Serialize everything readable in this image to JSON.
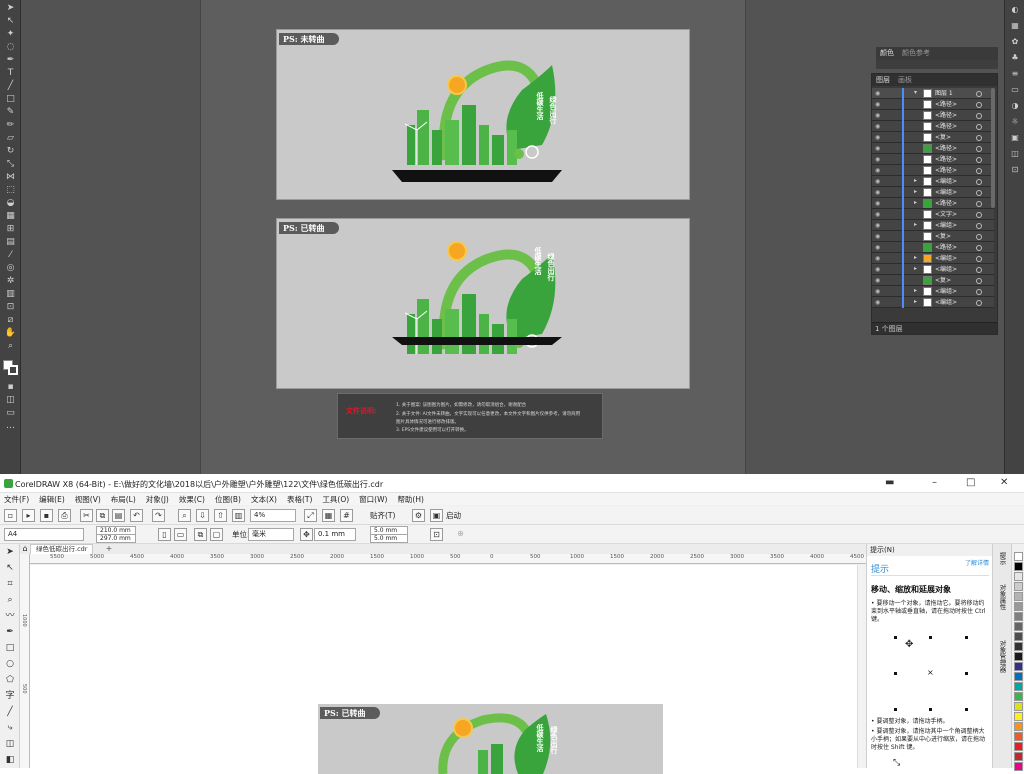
{
  "ai": {
    "poster1_tag": "PS: 未转曲",
    "poster2_tag": "PS: 已转曲",
    "poster_text_a": "低碳生活",
    "poster_text_b": "绿色出行",
    "note": {
      "title": "文件说明:",
      "lines": [
        "1. 关于图案: 该图图为图片，如需修改，请勿取消组合，谢谢配合",
        "2. 关于文件: AI文件未转曲，文字实现可以任意更改，本文件文字和图片仅供参考，请勿商用",
        "   图片具体情况可进行修改排版。",
        "3. EPS文件建议使用可以打开转换。"
      ]
    },
    "swatch_panel": {
      "tab1": "颜色",
      "tab2": "颜色参考"
    },
    "layers_panel": {
      "tab1": "图层",
      "tab2": "画板",
      "footer": "1 个图层",
      "rows": [
        {
          "name": "图层 1",
          "expanded": true
        },
        {
          "name": "<路径>"
        },
        {
          "name": "<路径>"
        },
        {
          "name": "<路径>"
        },
        {
          "name": "<复>"
        },
        {
          "name": "<路径>"
        },
        {
          "name": "<路径>"
        },
        {
          "name": "<路径>"
        },
        {
          "name": "<编组>",
          "arrow": true
        },
        {
          "name": "<编组>",
          "arrow": true
        },
        {
          "name": "<路径>",
          "arrow": true
        },
        {
          "name": "<文字>"
        },
        {
          "name": "<编组>",
          "arrow": true
        },
        {
          "name": "<复>"
        },
        {
          "name": "<路径>"
        },
        {
          "name": "<编组>",
          "arrow": true
        },
        {
          "name": "<编组>",
          "arrow": true
        },
        {
          "name": "<复>"
        },
        {
          "name": "<编组>",
          "arrow": true
        },
        {
          "name": "<编组>",
          "arrow": true
        }
      ]
    }
  },
  "cd": {
    "title": "CorelDRAW X8 (64-Bit) - E:\\做好的文化墙\\2018以后\\户外雕塑\\户外雕塑\\122\\文件\\绿色低碳出行.cdr",
    "menu": [
      "文件(F)",
      "编辑(E)",
      "视图(V)",
      "布局(L)",
      "对象(J)",
      "效果(C)",
      "位图(B)",
      "文本(X)",
      "表格(T)",
      "工具(O)",
      "窗口(W)",
      "帮助(H)"
    ],
    "zoom": "4%",
    "snap": "贴齐(T)",
    "launch": "启动",
    "page_size": "A4",
    "width": "210.0 mm",
    "height": "297.0 mm",
    "unit_label": "单位:",
    "unit": "毫米",
    "nudge": "0.1 mm",
    "dup_x": "5.0 mm",
    "dup_y": "5.0 mm",
    "doc_tab": "绿色低碳出行.cdr",
    "ruler_h": [
      "5500",
      "5000",
      "4500",
      "4000",
      "3500",
      "3000",
      "2500",
      "2000",
      "1500",
      "1000",
      "500",
      "0",
      "500",
      "1000",
      "1500",
      "2000",
      "2500",
      "3000",
      "3500",
      "4000",
      "4500"
    ],
    "ruler_v": [
      "1000",
      "500"
    ],
    "canvas_poster_tag": "PS: 已转曲",
    "canvas_poster_text_a": "低碳生活",
    "canvas_poster_text_b": "绿色出行",
    "hints": {
      "panel": "提示(N)",
      "tab": "提示",
      "learn": "了解详情",
      "heading": "移动、缩放和延展对象",
      "p1": "• 要移动一个对象，请拖动它。要将移动约束到水平轴或垂直轴，请在拖动时按住 Ctrl 键。",
      "p2": "• 要调整对象，请拖动手柄。",
      "p3": "• 要调整对象，请拖动其中一个角调整柄大小手柄；如果要从中心进行缩放，请在拖动时按住 Shift 键。"
    },
    "dock": [
      "提示",
      "对象属性",
      "对象管理器"
    ]
  }
}
